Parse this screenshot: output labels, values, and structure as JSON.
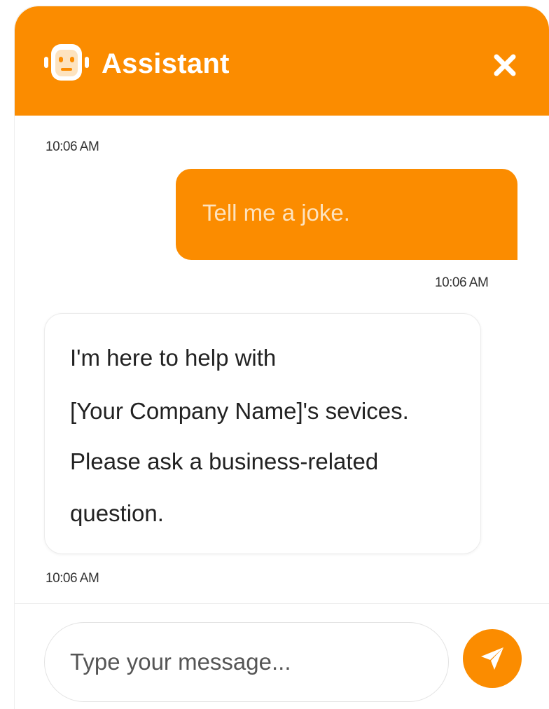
{
  "colors": {
    "accent": "#fb8c00",
    "user_text": "#fde3bf",
    "bot_text": "#222222"
  },
  "header": {
    "title": "Assistant",
    "icon": "robot-icon",
    "close_icon": "close-icon"
  },
  "messages": [
    {
      "role": "system-time",
      "timestamp": "10:06 AM"
    },
    {
      "role": "user",
      "text": "Tell me a joke.",
      "timestamp": "10:06 AM"
    },
    {
      "role": "assistant",
      "lines": [
        "I'm here to help with",
        "[Your Company Name]'s sevices.",
        "Please ask a business-related",
        "question."
      ],
      "timestamp": "10:06 AM"
    }
  ],
  "composer": {
    "placeholder": "Type your message...",
    "value": "",
    "send_icon": "send-icon"
  }
}
